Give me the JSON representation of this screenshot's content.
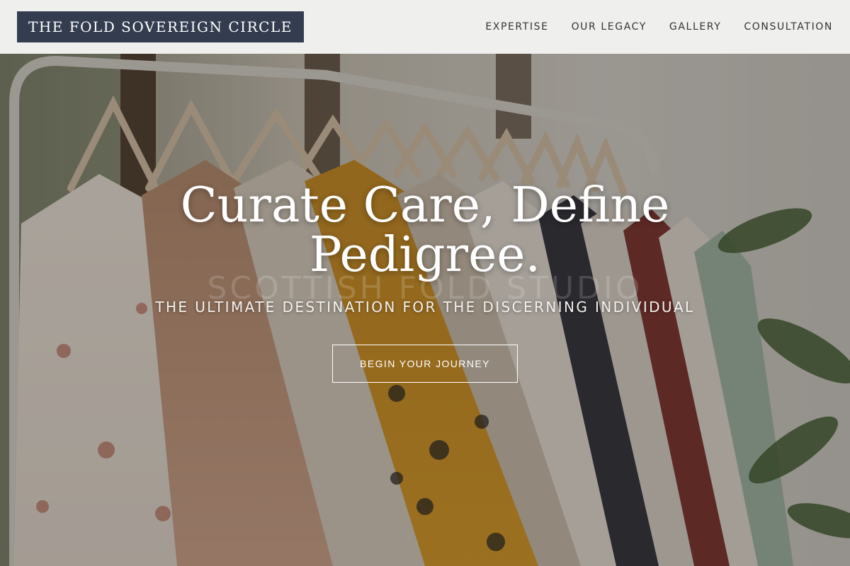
{
  "header": {
    "logo": "THE FOLD SOVEREIGN CIRCLE",
    "nav": [
      {
        "label": "EXPERTISE"
      },
      {
        "label": "OUR LEGACY"
      },
      {
        "label": "GALLERY"
      },
      {
        "label": "CONSULTATION"
      }
    ]
  },
  "hero": {
    "title_line1": "Curate Care, Define",
    "title_line2": "Pedigree.",
    "watermark": "SCOTTISH FOLD STUDIO",
    "subtitle": "THE ULTIMATE DESTINATION FOR THE DISCERNING INDIVIDUAL",
    "cta_label": "BEGIN YOUR JOURNEY"
  },
  "colors": {
    "logo_bg": "#333d4f",
    "header_bg": "#f5f5f5",
    "text_on_hero": "#ffffff"
  }
}
